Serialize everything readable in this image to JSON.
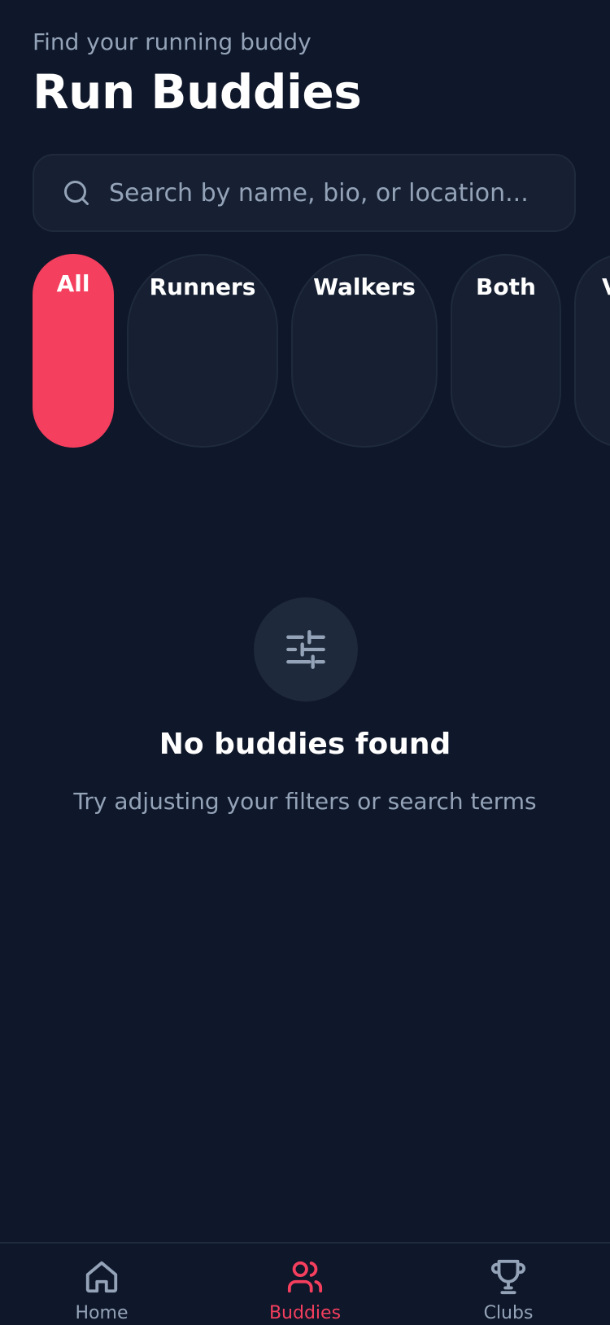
{
  "header": {
    "subtitle": "Find your running buddy",
    "title": "Run Buddies"
  },
  "search": {
    "placeholder": "Search by name, bio, or location...",
    "value": "",
    "icon": "search-icon"
  },
  "filters": {
    "active": "All",
    "items": [
      {
        "label": "All"
      },
      {
        "label": "Runners"
      },
      {
        "label": "Walkers"
      },
      {
        "label": "Both"
      },
      {
        "label": "V"
      }
    ]
  },
  "empty_state": {
    "icon": "sliders-icon",
    "title": "No buddies found",
    "message": "Try adjusting your filters or search terms"
  },
  "tabbar": {
    "active": "Buddies",
    "items": [
      {
        "label": "Home",
        "icon": "home-icon"
      },
      {
        "label": "Buddies",
        "icon": "users-icon"
      },
      {
        "label": "Clubs",
        "icon": "trophy-icon"
      }
    ]
  },
  "colors": {
    "background": "#0f172a",
    "surface": "#172033",
    "accent": "#f43f5e",
    "muted_text": "#94a3b8"
  }
}
